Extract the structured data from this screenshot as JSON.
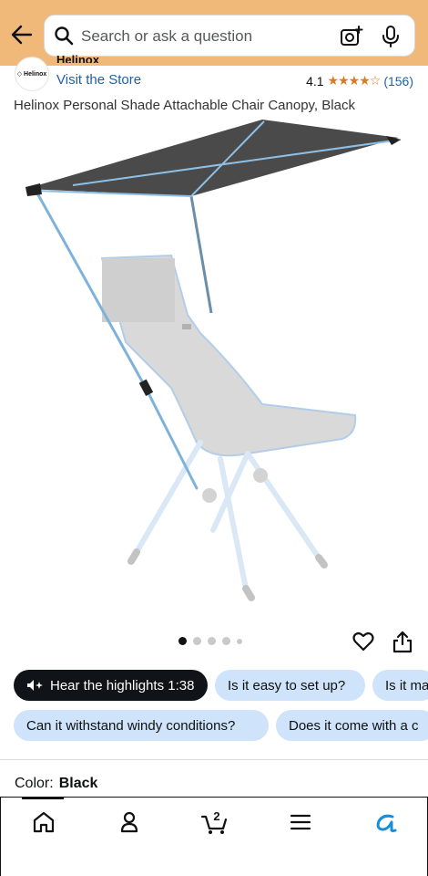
{
  "header": {
    "search_placeholder": "Search or ask a question"
  },
  "store": {
    "logo_text": "◇ Helinox",
    "brand_cut": "Helinox",
    "visit_label": "Visit the Store",
    "rating_value": "4.1",
    "stars": "★★★★☆",
    "rating_count": "(156)"
  },
  "product": {
    "title": "Helinox Personal Shade Attachable Chair Canopy, Black",
    "image_count": 5,
    "active_image": 1
  },
  "chips": {
    "hear_highlights": "Hear the highlights 1:38",
    "q1": "Is it easy to set up?",
    "q2": "Is it ma",
    "q3": "Can it withstand windy conditions?",
    "q4": "Does it come with a c"
  },
  "options": {
    "color_label": "Color:",
    "color_value": "Black"
  },
  "cart": {
    "count": "2"
  },
  "colors": {
    "header_bg": "#f0b97a",
    "link": "#2162a1",
    "chip_bg": "#cfe3fb",
    "star": "#de7921",
    "rufus": "#1a8cd8"
  }
}
